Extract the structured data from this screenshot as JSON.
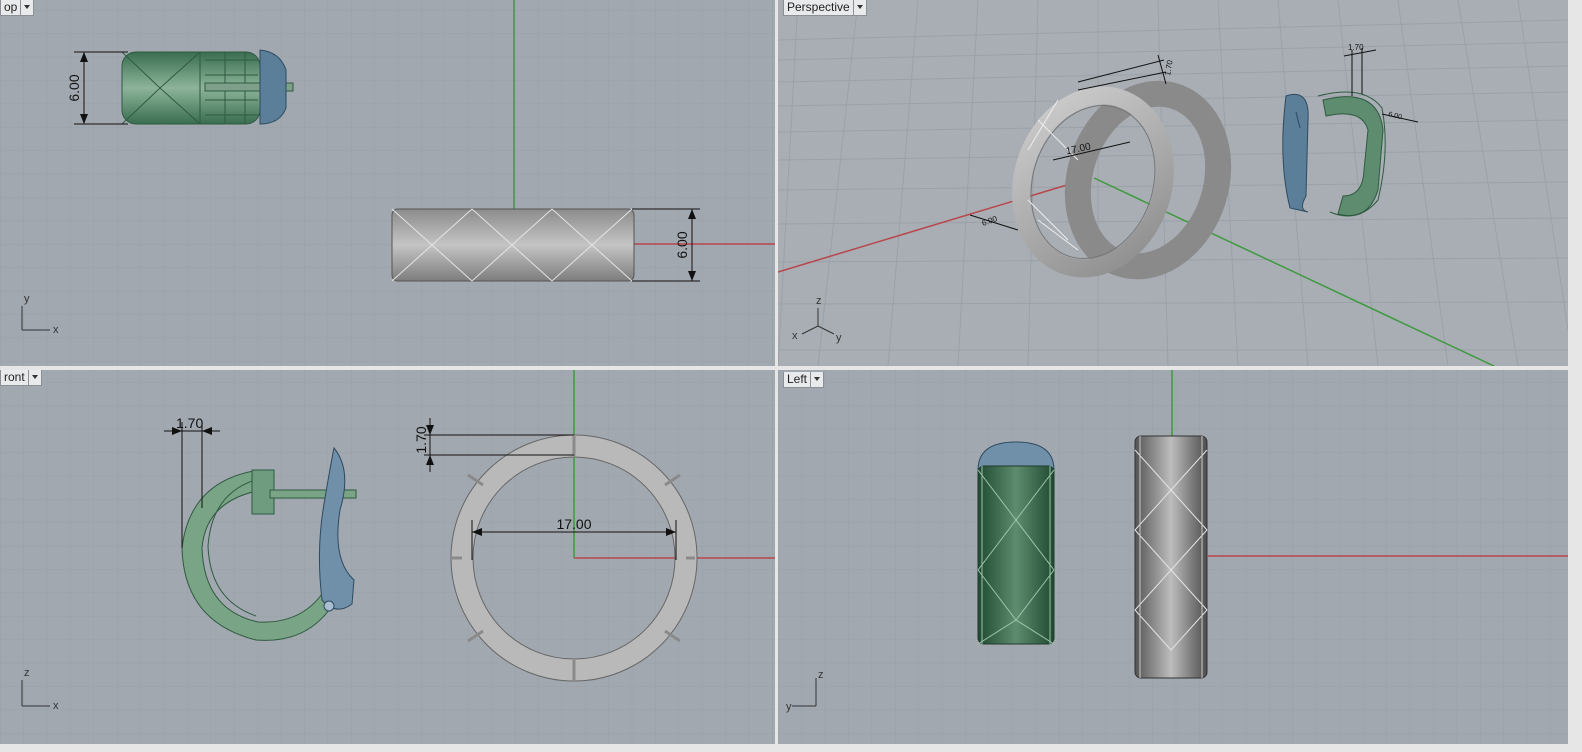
{
  "viewports": {
    "top": {
      "label": "Top",
      "label_visible": "op",
      "axes": [
        "y",
        "x"
      ]
    },
    "perspective": {
      "label": "Perspective",
      "axes": [
        "z",
        "x",
        "y"
      ]
    },
    "front": {
      "label": "Front",
      "label_visible": "ront",
      "axes": [
        "z",
        "x"
      ]
    },
    "left": {
      "label": "Left",
      "axes": [
        "z",
        "y"
      ]
    }
  },
  "dimensions": {
    "top_height_earring": "6.00",
    "top_height_ring": "6.00",
    "front_width": "1.70",
    "front_thickness": "1.70",
    "front_diameter": "17.00",
    "persp_diameter": "17.00",
    "persp_width": "6.00",
    "persp_thickness": "1.70",
    "persp_earring_thickness": "1.70",
    "persp_earring_width": "6.00"
  },
  "colors": {
    "viewport_bg": "#a2a8b0",
    "grid_minor": "#98a0a8",
    "grid_major": "#8a9199",
    "x_axis": "#b8464a",
    "y_axis": "#3e9a3e",
    "earring_body": "#3f7a5a",
    "earring_clasp": "#5b7f99",
    "ring_metal": "#a9a9a9"
  }
}
